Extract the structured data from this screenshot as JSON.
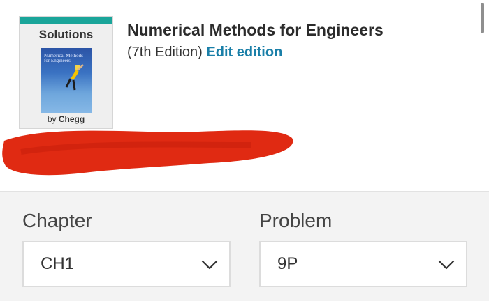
{
  "cover": {
    "solutions_label": "Solutions",
    "book_cover_title": "Numerical Methods for Engineers",
    "by_label": "by",
    "brand": "Chegg"
  },
  "book": {
    "title": "Numerical Methods for Engineers",
    "edition": "(7th Edition)",
    "edit_label": "Edit edition"
  },
  "selectors": {
    "chapter": {
      "label": "Chapter",
      "value": "CH1",
      "icon": "chevron-down-icon"
    },
    "problem": {
      "label": "Problem",
      "value": "9P",
      "icon": "chevron-down-icon"
    }
  },
  "colors": {
    "accent": "#1aa59a",
    "link": "#1a7fa8",
    "redaction": "#e02a12",
    "panel_bg": "#f3f3f3"
  }
}
